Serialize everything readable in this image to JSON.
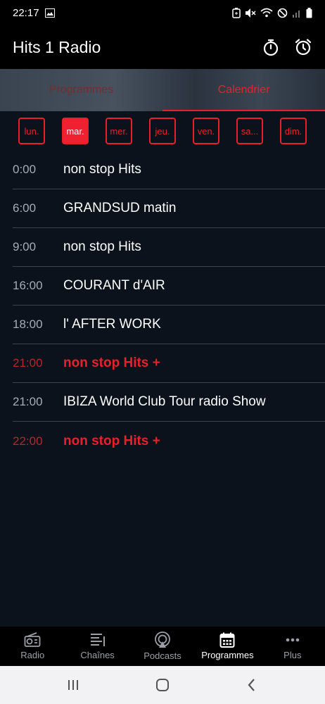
{
  "status_bar": {
    "time": "22:17"
  },
  "app": {
    "title": "Hits 1 Radio",
    "timer_icon": "timer-icon",
    "alarm_icon": "alarm-icon"
  },
  "tabs": [
    {
      "label": "Programmes",
      "active": false
    },
    {
      "label": "Calendrier",
      "active": true
    }
  ],
  "days": [
    {
      "label": "lun.",
      "selected": false
    },
    {
      "label": "mar.",
      "selected": true
    },
    {
      "label": "mer.",
      "selected": false
    },
    {
      "label": "jeu.",
      "selected": false
    },
    {
      "label": "ven.",
      "selected": false
    },
    {
      "label": "sa...",
      "selected": false
    },
    {
      "label": "dim.",
      "selected": false
    }
  ],
  "schedule": [
    {
      "time": "0:00",
      "title": "non stop Hits",
      "live": false
    },
    {
      "time": "6:00",
      "title": "GRANDSUD matin",
      "live": false
    },
    {
      "time": "9:00",
      "title": "non stop Hits",
      "live": false
    },
    {
      "time": "16:00",
      "title": "COURANT d'AIR",
      "live": false
    },
    {
      "time": "18:00",
      "title": "l' AFTER WORK",
      "live": false
    },
    {
      "time": "21:00",
      "title": "non stop Hits +",
      "live": true
    },
    {
      "time": "21:00",
      "title": "IBIZA World Club Tour radio Show",
      "live": false
    },
    {
      "time": "22:00",
      "title": "non stop Hits +",
      "live": true
    }
  ],
  "bottom_nav": [
    {
      "label": "Radio",
      "icon": "radio-icon",
      "active": false
    },
    {
      "label": "Chaînes",
      "icon": "list-icon",
      "active": false
    },
    {
      "label": "Podcasts",
      "icon": "podcast-icon",
      "active": false
    },
    {
      "label": "Programmes",
      "icon": "calendar-icon",
      "active": true
    },
    {
      "label": "Plus",
      "icon": "more-icon",
      "active": false
    }
  ],
  "colors": {
    "accent": "#e8202a",
    "background": "#0c121c",
    "selected_day": "#ef2030"
  }
}
